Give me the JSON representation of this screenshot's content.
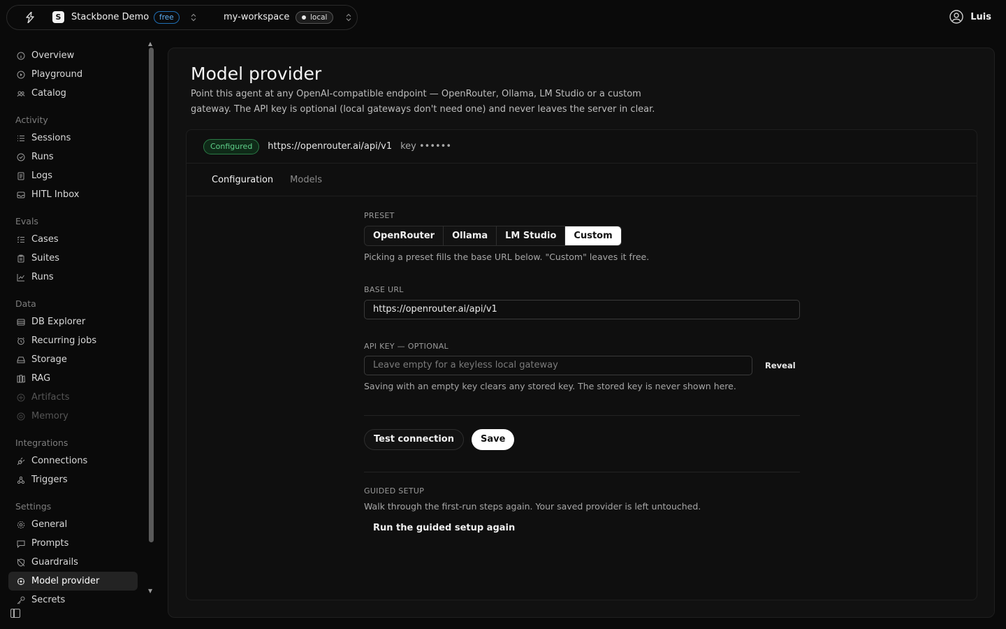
{
  "topbar": {
    "org_initial": "S",
    "org_name": "Stackbone Demo",
    "plan": "free",
    "workspace": "my-workspace",
    "environment": "local",
    "user_name": "Luis"
  },
  "sidebar": {
    "top_items": [
      "Overview",
      "Playground",
      "Catalog"
    ],
    "activity": {
      "label": "Activity",
      "items": [
        "Sessions",
        "Runs",
        "Logs",
        "HITL Inbox"
      ]
    },
    "evals": {
      "label": "Evals",
      "items": [
        "Cases",
        "Suites",
        "Runs"
      ]
    },
    "data": {
      "label": "Data",
      "items": [
        "DB Explorer",
        "Recurring jobs",
        "Storage",
        "RAG",
        "Artifacts",
        "Memory"
      ]
    },
    "integrations": {
      "label": "Integrations",
      "items": [
        "Connections",
        "Triggers"
      ]
    },
    "settings": {
      "label": "Settings",
      "items": [
        "General",
        "Prompts",
        "Guardrails",
        "Model provider",
        "Secrets"
      ]
    },
    "active_item": "Model provider",
    "disabled_items": [
      "Artifacts",
      "Memory"
    ]
  },
  "page": {
    "title": "Model provider",
    "description": "Point this agent at any OpenAI-compatible endpoint — OpenRouter, Ollama, LM Studio or a custom gateway. The API key is optional (local gateways don't need one) and never leaves the server in clear."
  },
  "status": {
    "badge": "Configured",
    "url": "https://openrouter.ai/api/v1",
    "key_label": "key ••••••",
    "badge_color": "#5fd08a"
  },
  "tabs": [
    {
      "label": "Configuration",
      "active": true
    },
    {
      "label": "Models",
      "active": false
    }
  ],
  "form": {
    "preset_label": "PRESET",
    "presets": [
      "OpenRouter",
      "Ollama",
      "LM Studio",
      "Custom"
    ],
    "selected_preset": "Custom",
    "preset_hint": "Picking a preset fills the base URL below. \"Custom\" leaves it free.",
    "base_url_label": "BASE URL",
    "base_url_value": "https://openrouter.ai/api/v1",
    "api_key_label": "API KEY — OPTIONAL",
    "api_key_placeholder": "Leave empty for a keyless local gateway",
    "reveal_label": "Reveal",
    "api_key_hint": "Saving with an empty key clears any stored key. The stored key is never shown here.",
    "test_button": "Test connection",
    "save_button": "Save",
    "guided_label": "GUIDED SETUP",
    "guided_hint": "Walk through the first-run steps again. Your saved provider is left untouched.",
    "guided_button": "Run the guided setup again"
  }
}
